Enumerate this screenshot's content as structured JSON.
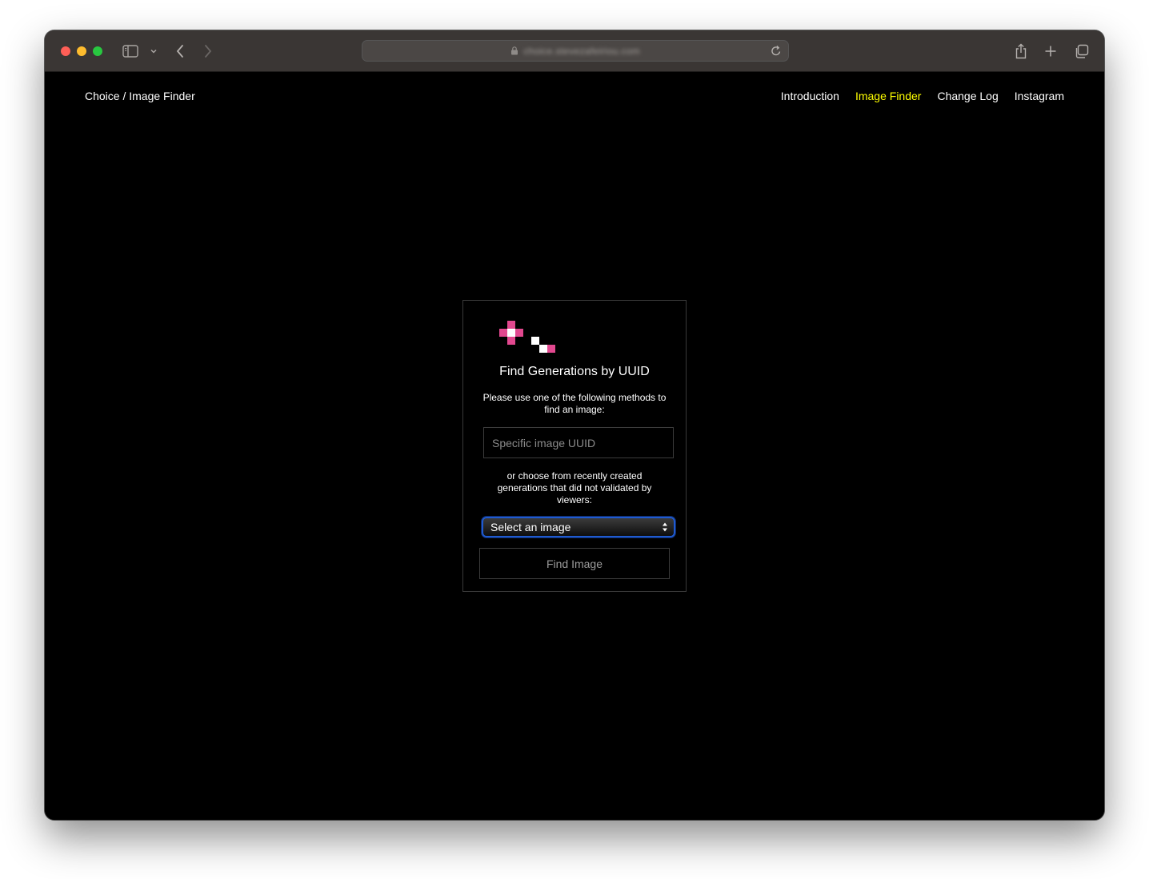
{
  "browser": {
    "url": "choice.stevezafeiriou.com"
  },
  "header": {
    "brand": "Choice / Image Finder",
    "nav": [
      {
        "label": "Introduction",
        "active": false
      },
      {
        "label": "Image Finder",
        "active": true
      },
      {
        "label": "Change Log",
        "active": false
      },
      {
        "label": "Instagram",
        "active": false
      }
    ],
    "active_color": "#ffff00"
  },
  "finder": {
    "title": "Find Generations by UUID",
    "description": "Please use one of the following methods to find an image:",
    "uuid_placeholder": "Specific image UUID",
    "alternative_text": "or choose from recently created generations that did not validated by viewers:",
    "select_value": "Select an image",
    "find_button": "Find Image",
    "logo_colors": {
      "pink": "#e2488f",
      "white": "#ffffff"
    }
  }
}
